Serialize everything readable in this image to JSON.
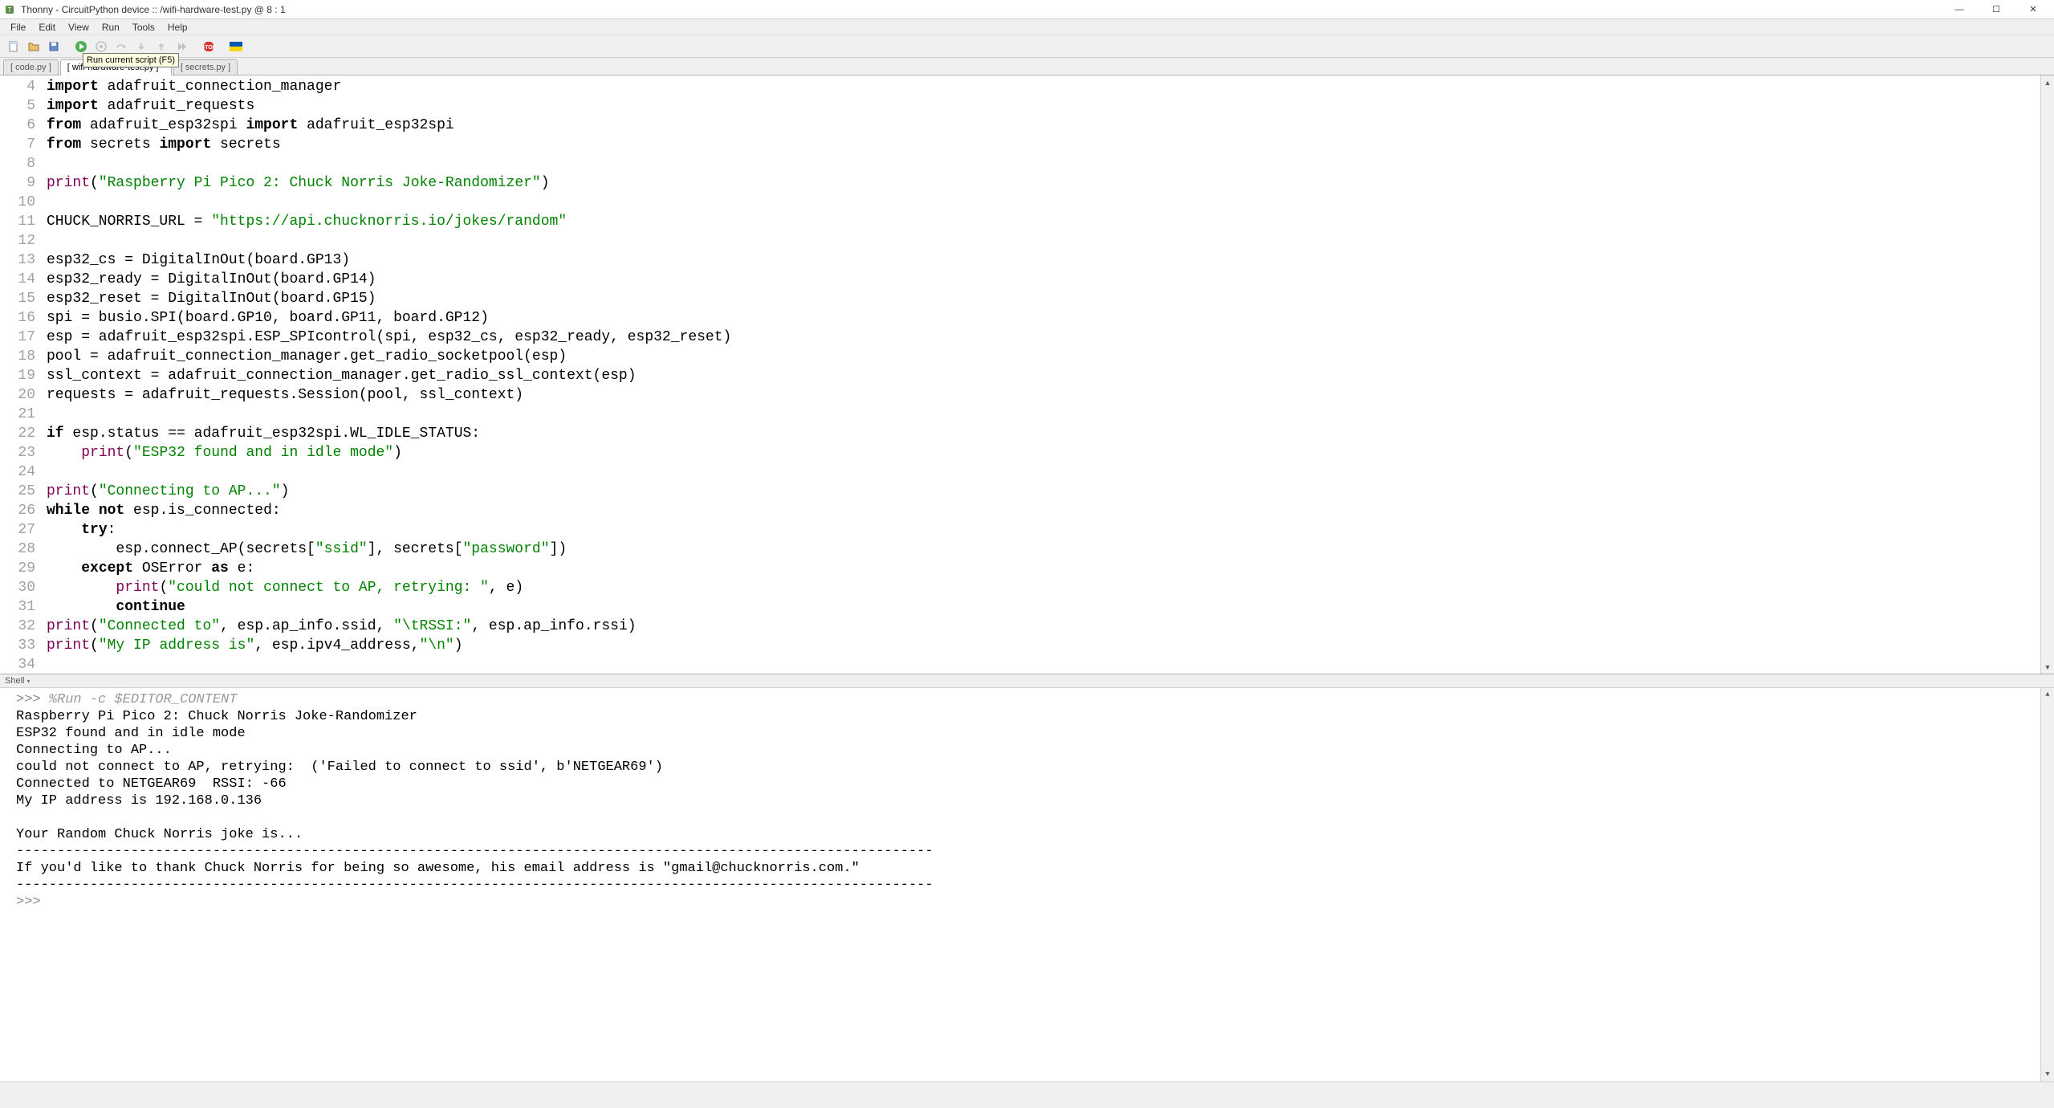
{
  "title": "Thonny  -  CircuitPython device :: /wifi-hardware-test.py  @  8 : 1",
  "menu": [
    "File",
    "Edit",
    "View",
    "Run",
    "Tools",
    "Help"
  ],
  "tooltip": "Run current script (F5)",
  "tabs": [
    {
      "label": "[ code.py ]",
      "active": false
    },
    {
      "label": "[ wifi-hardware-test.py ] *",
      "active": true
    },
    {
      "label": "[ secrets.py ]",
      "active": false
    }
  ],
  "shell_label": "Shell",
  "code_lines": [
    {
      "n": 4,
      "tokens": [
        {
          "t": "import",
          "c": "kw"
        },
        {
          "t": " adafruit_connection_manager",
          "c": ""
        }
      ]
    },
    {
      "n": 5,
      "tokens": [
        {
          "t": "import",
          "c": "kw"
        },
        {
          "t": " adafruit_requests",
          "c": ""
        }
      ]
    },
    {
      "n": 6,
      "tokens": [
        {
          "t": "from",
          "c": "kw"
        },
        {
          "t": " adafruit_esp32spi ",
          "c": ""
        },
        {
          "t": "import",
          "c": "kw"
        },
        {
          "t": " adafruit_esp32spi",
          "c": ""
        }
      ]
    },
    {
      "n": 7,
      "tokens": [
        {
          "t": "from",
          "c": "kw"
        },
        {
          "t": " secrets ",
          "c": ""
        },
        {
          "t": "import",
          "c": "kw"
        },
        {
          "t": " secrets",
          "c": ""
        }
      ]
    },
    {
      "n": 8,
      "tokens": []
    },
    {
      "n": 9,
      "tokens": [
        {
          "t": "print",
          "c": "fn"
        },
        {
          "t": "(",
          "c": ""
        },
        {
          "t": "\"Raspberry Pi Pico 2: Chuck Norris Joke-Randomizer\"",
          "c": "str"
        },
        {
          "t": ")",
          "c": ""
        }
      ]
    },
    {
      "n": 10,
      "tokens": []
    },
    {
      "n": 11,
      "tokens": [
        {
          "t": "CHUCK_NORRIS_URL = ",
          "c": ""
        },
        {
          "t": "\"https://api.chucknorris.io/jokes/random\"",
          "c": "str"
        }
      ]
    },
    {
      "n": 12,
      "tokens": []
    },
    {
      "n": 13,
      "tokens": [
        {
          "t": "esp32_cs = DigitalInOut(board.GP13)",
          "c": ""
        }
      ]
    },
    {
      "n": 14,
      "tokens": [
        {
          "t": "esp32_ready = DigitalInOut(board.GP14)",
          "c": ""
        }
      ]
    },
    {
      "n": 15,
      "tokens": [
        {
          "t": "esp32_reset = DigitalInOut(board.GP15)",
          "c": ""
        }
      ]
    },
    {
      "n": 16,
      "tokens": [
        {
          "t": "spi = busio.SPI(board.GP10, board.GP11, board.GP12)",
          "c": ""
        }
      ]
    },
    {
      "n": 17,
      "tokens": [
        {
          "t": "esp = adafruit_esp32spi.ESP_SPIcontrol(spi, esp32_cs, esp32_ready, esp32_reset)",
          "c": ""
        }
      ]
    },
    {
      "n": 18,
      "tokens": [
        {
          "t": "pool = adafruit_connection_manager.get_radio_socketpool(esp)",
          "c": ""
        }
      ]
    },
    {
      "n": 19,
      "tokens": [
        {
          "t": "ssl_context = adafruit_connection_manager.get_radio_ssl_context(esp)",
          "c": ""
        }
      ]
    },
    {
      "n": 20,
      "tokens": [
        {
          "t": "requests = adafruit_requests.Session(pool, ssl_context)",
          "c": ""
        }
      ]
    },
    {
      "n": 21,
      "tokens": []
    },
    {
      "n": 22,
      "tokens": [
        {
          "t": "if",
          "c": "kw"
        },
        {
          "t": " esp.status == adafruit_esp32spi.WL_IDLE_STATUS:",
          "c": ""
        }
      ]
    },
    {
      "n": 23,
      "tokens": [
        {
          "t": "    ",
          "c": ""
        },
        {
          "t": "print",
          "c": "fn"
        },
        {
          "t": "(",
          "c": ""
        },
        {
          "t": "\"ESP32 found and in idle mode\"",
          "c": "str"
        },
        {
          "t": ")",
          "c": ""
        }
      ]
    },
    {
      "n": 24,
      "tokens": []
    },
    {
      "n": 25,
      "tokens": [
        {
          "t": "print",
          "c": "fn"
        },
        {
          "t": "(",
          "c": ""
        },
        {
          "t": "\"Connecting to AP...\"",
          "c": "str"
        },
        {
          "t": ")",
          "c": ""
        }
      ]
    },
    {
      "n": 26,
      "tokens": [
        {
          "t": "while",
          "c": "kw"
        },
        {
          "t": " ",
          "c": ""
        },
        {
          "t": "not",
          "c": "kw"
        },
        {
          "t": " esp.is_connected:",
          "c": ""
        }
      ]
    },
    {
      "n": 27,
      "tokens": [
        {
          "t": "    ",
          "c": ""
        },
        {
          "t": "try",
          "c": "kw"
        },
        {
          "t": ":",
          "c": ""
        }
      ]
    },
    {
      "n": 28,
      "tokens": [
        {
          "t": "        esp.connect_AP(secrets[",
          "c": ""
        },
        {
          "t": "\"ssid\"",
          "c": "str"
        },
        {
          "t": "], secrets[",
          "c": ""
        },
        {
          "t": "\"password\"",
          "c": "str"
        },
        {
          "t": "])",
          "c": ""
        }
      ]
    },
    {
      "n": 29,
      "tokens": [
        {
          "t": "    ",
          "c": ""
        },
        {
          "t": "except",
          "c": "kw"
        },
        {
          "t": " OSError ",
          "c": ""
        },
        {
          "t": "as",
          "c": "kw"
        },
        {
          "t": " e:",
          "c": ""
        }
      ]
    },
    {
      "n": 30,
      "tokens": [
        {
          "t": "        ",
          "c": ""
        },
        {
          "t": "print",
          "c": "fn"
        },
        {
          "t": "(",
          "c": ""
        },
        {
          "t": "\"could not connect to AP, retrying: \"",
          "c": "str"
        },
        {
          "t": ", e)",
          "c": ""
        }
      ]
    },
    {
      "n": 31,
      "tokens": [
        {
          "t": "        ",
          "c": ""
        },
        {
          "t": "continue",
          "c": "kw"
        }
      ]
    },
    {
      "n": 32,
      "tokens": [
        {
          "t": "print",
          "c": "fn"
        },
        {
          "t": "(",
          "c": ""
        },
        {
          "t": "\"Connected to\"",
          "c": "str"
        },
        {
          "t": ", esp.ap_info.ssid, ",
          "c": ""
        },
        {
          "t": "\"\\tRSSI:\"",
          "c": "str"
        },
        {
          "t": ", esp.ap_info.rssi)",
          "c": ""
        }
      ]
    },
    {
      "n": 33,
      "tokens": [
        {
          "t": "print",
          "c": "fn"
        },
        {
          "t": "(",
          "c": ""
        },
        {
          "t": "\"My IP address is\"",
          "c": "str"
        },
        {
          "t": ", esp.ipv4_address,",
          "c": ""
        },
        {
          "t": "\"\\n\"",
          "c": "str"
        },
        {
          "t": ")",
          "c": ""
        }
      ]
    },
    {
      "n": 34,
      "tokens": []
    }
  ],
  "shell": {
    "prompt": ">>>",
    "run_cmd": " %Run -c $EDITOR_CONTENT",
    "output": "Raspberry Pi Pico 2: Chuck Norris Joke-Randomizer\nESP32 found and in idle mode\nConnecting to AP...\ncould not connect to AP, retrying:  ('Failed to connect to ssid', b'NETGEAR69')\nConnected to NETGEAR69  RSSI: -66\nMy IP address is 192.168.0.136\n\nYour Random Chuck Norris joke is...\n----------------------------------------------------------------------------------------------------------------\nIf you'd like to thank Chuck Norris for being so awesome, his email address is \"gmail@chucknorris.com.\"\n----------------------------------------------------------------------------------------------------------------\n"
  }
}
